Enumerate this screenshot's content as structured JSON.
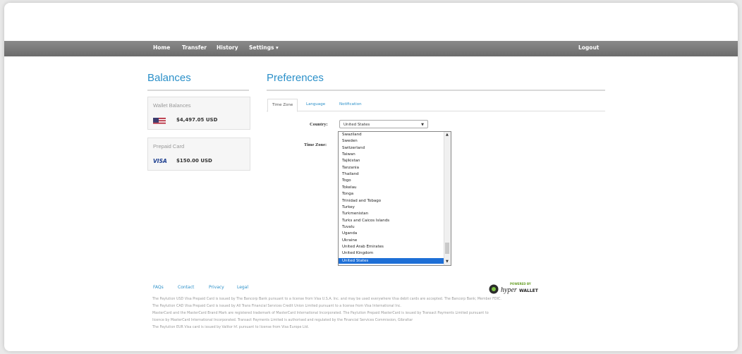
{
  "nav": {
    "home": "Home",
    "transfer": "Transfer",
    "history": "History",
    "settings": "Settings ▾",
    "logout": "Logout"
  },
  "balances": {
    "heading": "Balances",
    "wallet_title": "Wallet Balances",
    "wallet_amount": "$4,497.05 USD",
    "prepaid_title": "Prepaid Card",
    "prepaid_brand": "VISA",
    "prepaid_amount": "$150.00 USD"
  },
  "preferences": {
    "heading": "Preferences",
    "tabs": [
      "Time Zone",
      "Language",
      "Notification"
    ],
    "country_label": "Country:",
    "country_value": "United States",
    "timezone_label": "Time Zone:"
  },
  "dropdown_options": [
    "Swaziland",
    "Sweden",
    "Switzerland",
    "Taiwan",
    "Tajikistan",
    "Tanzania",
    "Thailand",
    "Togo",
    "Tokelau",
    "Tonga",
    "Trinidad and Tobago",
    "Turkey",
    "Turkmenistan",
    "Turks and Caicos Islands",
    "Tuvalu",
    "Uganda",
    "Ukraine",
    "United Arab Emirates",
    "United Kingdom",
    "United States"
  ],
  "footer": {
    "links": [
      "FAQs",
      "Contact",
      "Privacy",
      "Legal"
    ],
    "powered_by": "POWERED BY",
    "brand_hyper": "hyper",
    "brand_wallet": "WALLET",
    "lines": [
      "The Paylution USD Visa Prepaid Card is issued by The Bancorp Bank pursuant to a license from Visa U.S.A. Inc. and may be used everywhere Visa debit cards are accepted. The Bancorp Bank; Member FDIC.",
      "The Paylution CAD Visa Prepaid Card is issued by All Trans Financial Services Credit Union Limited pursuant to a license from Visa International Inc.",
      "MasterCard and the MasterCard Brand Mark are registered trademark of MasterCard International Incorporated. The Paylution Prepaid MasterCard is issued by Transact Payments Limited pursuant to",
      "licence by MasterCard International Incorporated. Transact Payments Limited is authorised and regulated by the Financial Services Commission, Gibraltar",
      "The Paylution EUR Visa card is issued by Valitor hf. pursuant to license from Visa Europe Ltd."
    ]
  },
  "colors": {
    "accent": "#2b90c9",
    "navbar": "#7a7a7a",
    "selected_option": "#1e6fd6"
  }
}
